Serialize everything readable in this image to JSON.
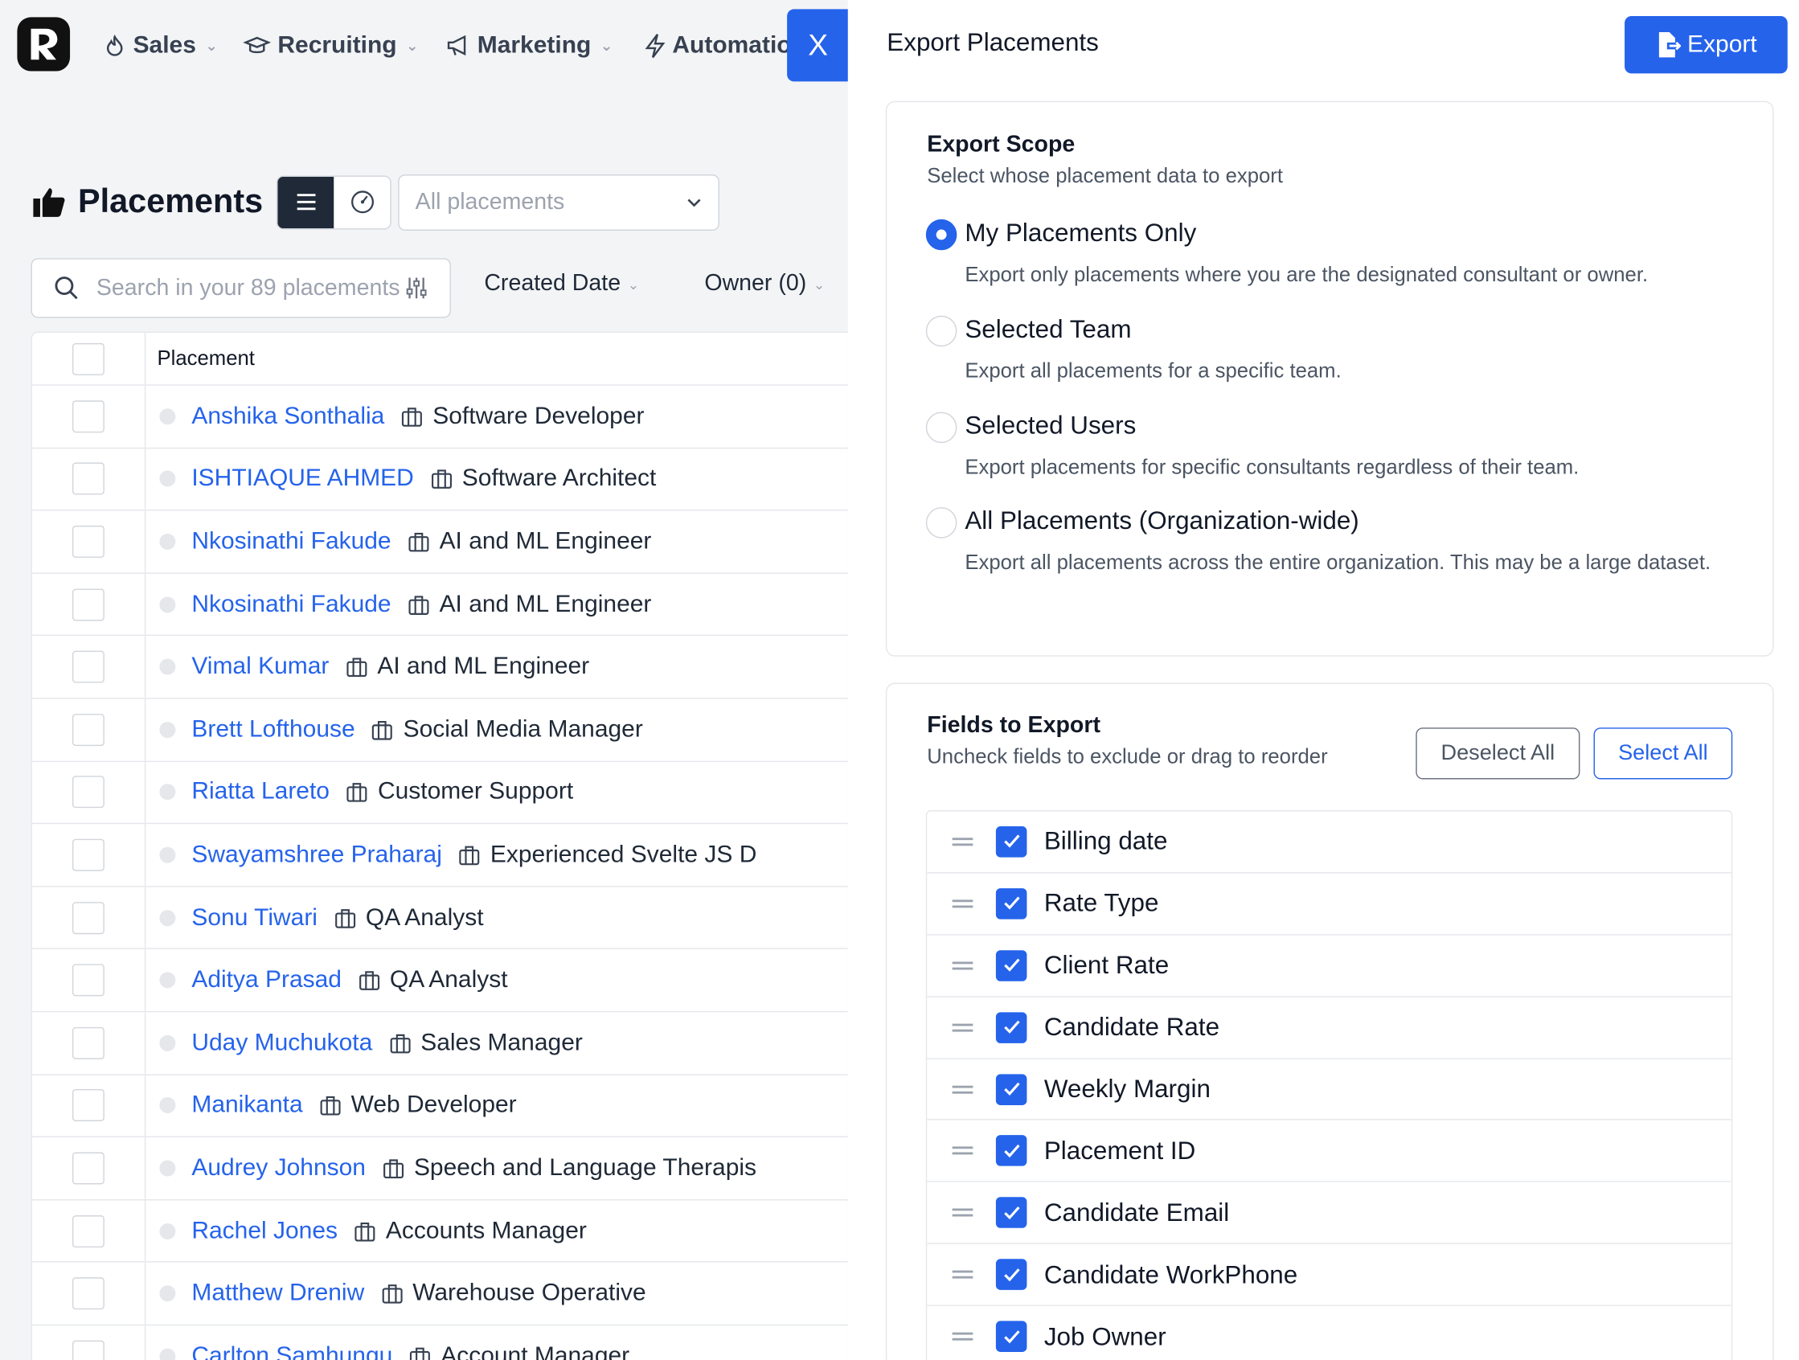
{
  "nav": {
    "items": [
      {
        "label": "Sales",
        "icon": "flame-icon"
      },
      {
        "label": "Recruiting",
        "icon": "graduation-cap-icon"
      },
      {
        "label": "Marketing",
        "icon": "megaphone-icon"
      },
      {
        "label": "Automatio",
        "icon": "lightning-icon"
      }
    ],
    "close_label": "X"
  },
  "page": {
    "title": "Placements",
    "view_select": "All placements",
    "search_placeholder": "Search in your 89 placements",
    "filters": {
      "created_date": "Created Date",
      "owner": "Owner (0)"
    }
  },
  "table": {
    "header": "Placement",
    "rows": [
      {
        "name": "Anshika Sonthalia",
        "job": "Software Developer"
      },
      {
        "name": "ISHTIAQUE AHMED",
        "job": "Software Architect"
      },
      {
        "name": "Nkosinathi Fakude",
        "job": "AI and ML Engineer"
      },
      {
        "name": "Nkosinathi Fakude",
        "job": "AI and ML Engineer"
      },
      {
        "name": "Vimal Kumar",
        "job": "AI and ML Engineer"
      },
      {
        "name": "Brett Lofthouse",
        "job": "Social Media Manager"
      },
      {
        "name": "Riatta Lareto",
        "job": "Customer Support"
      },
      {
        "name": "Swayamshree Praharaj",
        "job": "Experienced Svelte JS D"
      },
      {
        "name": "Sonu Tiwari",
        "job": "QA Analyst"
      },
      {
        "name": "Aditya Prasad",
        "job": "QA Analyst"
      },
      {
        "name": "Uday Muchukota",
        "job": "Sales Manager"
      },
      {
        "name": "Manikanta",
        "job": "Web Developer"
      },
      {
        "name": "Audrey Johnson",
        "job": "Speech and Language Therapis"
      },
      {
        "name": "Rachel Jones",
        "job": "Accounts Manager"
      },
      {
        "name": "Matthew Dreniw",
        "job": "Warehouse Operative"
      },
      {
        "name": "Carlton Samhungu",
        "job": "Account Manager"
      }
    ]
  },
  "panel": {
    "title": "Export Placements",
    "export_label": "Export",
    "scope": {
      "heading": "Export Scope",
      "subheading": "Select whose placement data to export",
      "selected": "My Placements Only",
      "options": [
        {
          "label": "My Placements Only",
          "desc": "Export only placements where you are the designated consultant or owner."
        },
        {
          "label": "Selected Team",
          "desc": "Export all placements for a specific team."
        },
        {
          "label": "Selected Users",
          "desc": "Export placements for specific consultants regardless of their team."
        },
        {
          "label": "All Placements (Organization-wide)",
          "desc": "Export all placements across the entire organization. This may be a large dataset."
        }
      ]
    },
    "fields": {
      "heading": "Fields to Export",
      "subheading": "Uncheck fields to exclude or drag to reorder",
      "deselect_all": "Deselect All",
      "select_all": "Select All",
      "items": [
        {
          "label": "Billing date",
          "checked": true
        },
        {
          "label": "Rate Type",
          "checked": true
        },
        {
          "label": "Client Rate",
          "checked": true
        },
        {
          "label": "Candidate Rate",
          "checked": true
        },
        {
          "label": "Weekly Margin",
          "checked": true
        },
        {
          "label": "Placement ID",
          "checked": true
        },
        {
          "label": "Candidate Email",
          "checked": true
        },
        {
          "label": "Candidate WorkPhone",
          "checked": true
        },
        {
          "label": "Job Owner",
          "checked": true
        }
      ]
    }
  },
  "colors": {
    "accent": "#2563eb",
    "dark": "#1f2937",
    "link": "#2563eb"
  }
}
